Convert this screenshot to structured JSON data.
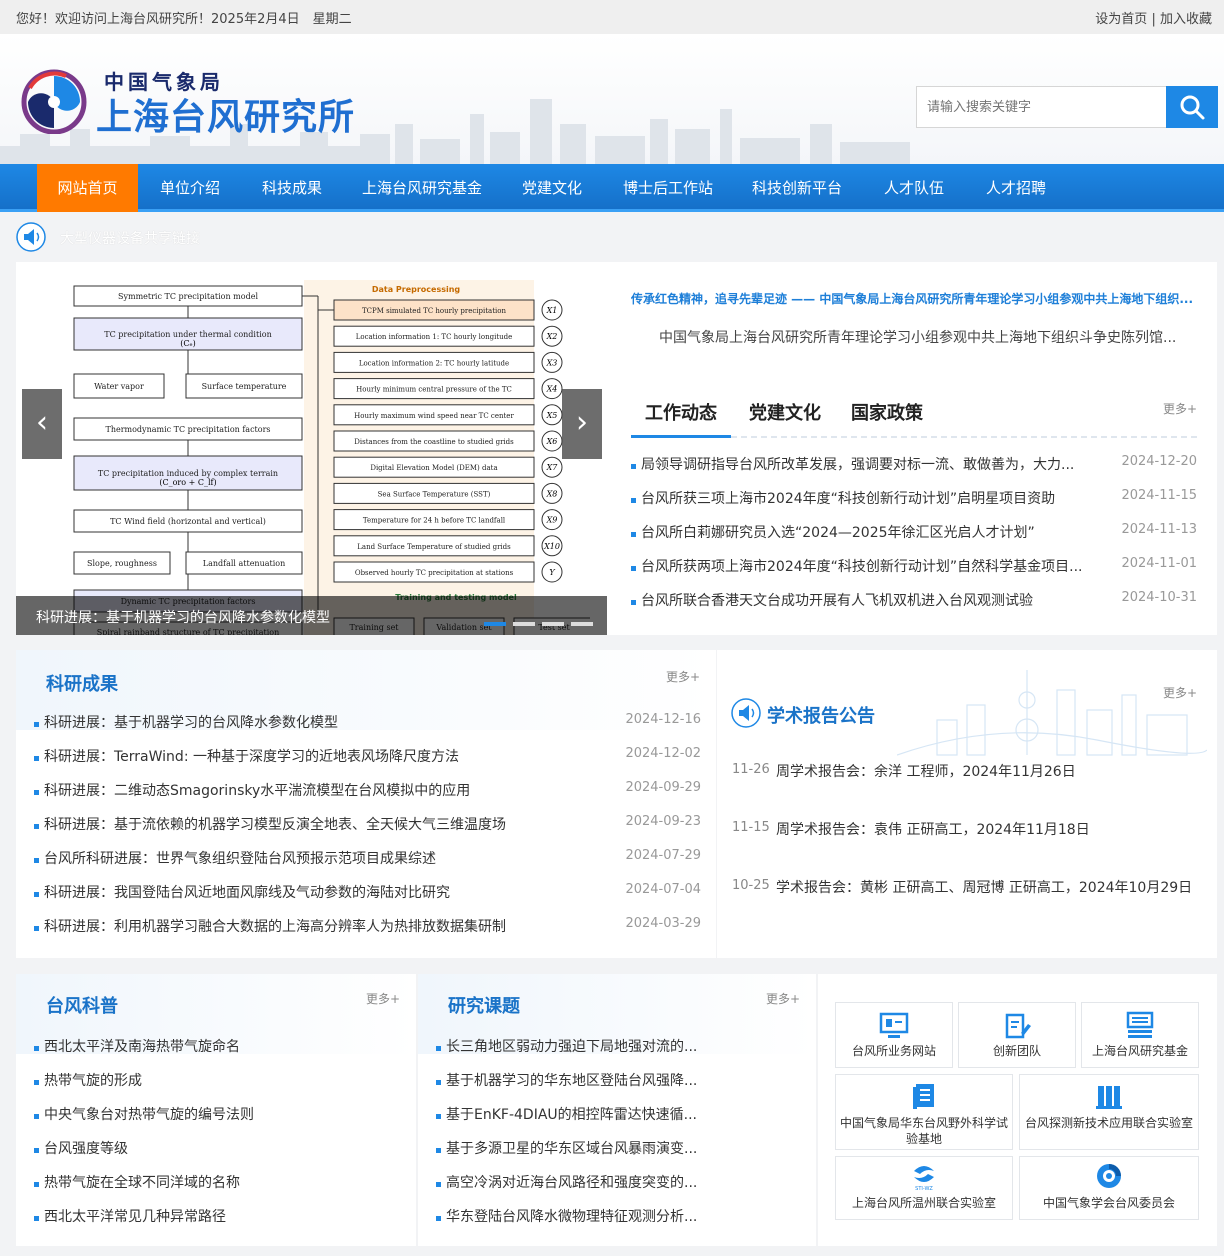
{
  "topbar": {
    "welcome": "您好！欢迎访问上海台风研究所！2025年2月4日　星期二",
    "set_home": "设为首页",
    "sep": "|",
    "favorite": "加入收藏"
  },
  "header": {
    "org": "中国气象局",
    "name": "上海台风研究所",
    "search_placeholder": "请输入搜索关键字"
  },
  "nav": {
    "items": [
      "网站首页",
      "单位介绍",
      "科技成果",
      "上海台风研究基金",
      "党建文化",
      "博士后工作站",
      "科技创新平台",
      "人才队伍",
      "人才招聘"
    ],
    "active_index": 0
  },
  "notice": {
    "text": "大型仪器设备共享链接"
  },
  "slider": {
    "caption": "科研进展：基于机器学习的台风降水参数化模型",
    "dot_count": 5,
    "active_dot": 0,
    "figure": {
      "left_boxes": [
        "Symmetric TC precipitation model",
        "TC precipitation under thermal condition",
        "(Cₑ)",
        "Water vapor",
        "Surface temperature",
        "Thermodynamic TC precipitation factors",
        "TC precipitation induced by complex terrain",
        "(C_oro + C_lf)",
        "TC Wind field (horizontal and vertical)",
        "Slope, roughness",
        "Landfall attenuation",
        "Dynamic TC precipitation factors",
        "Spiral rainband structure of TC precipitation"
      ],
      "header": "Data Preprocessing",
      "right_boxes": [
        "TCPM simulated TC hourly precipitation",
        "Location information 1: TC hourly longitude",
        "Location information 2: TC hourly latitude",
        "Hourly minimum central pressure of the TC",
        "Hourly maximum wind speed near TC center",
        "Distances from the coastline to studied grids",
        "Digital Elevation Model (DEM) data",
        "Sea Surface Temperature (SST)",
        "Temperature for 24 h before TC landfall",
        "Land Surface Temperature of studied grids",
        "Observed hourly TC precipitation at stations"
      ],
      "x_labels": [
        "X1",
        "X2",
        "X3",
        "X4",
        "X5",
        "X6",
        "X7",
        "X8",
        "X9",
        "X10",
        "Y"
      ],
      "bottom_header": "Training and testing model",
      "bottom_boxes": [
        "Training set",
        "Validation set",
        "Test set"
      ]
    }
  },
  "featured": {
    "headline": "传承红色精神，追寻先辈足迹 —— 中国气象局上海台风研究所青年理论学习小组参观中共上海地下组织...",
    "summary": "中国气象局上海台风研究所青年理论学习小组参观中共上海地下组织斗争史陈列馆..."
  },
  "tabs": {
    "items": [
      "工作动态",
      "党建文化",
      "国家政策"
    ],
    "active": 0,
    "more": "更多+"
  },
  "news": [
    {
      "title": "局领导调研指导台风所改革发展，强调要对标一流、敢做善为，大力...",
      "date": "2024-12-20"
    },
    {
      "title": "台风所获三项上海市2024年度“科技创新行动计划”启明星项目资助",
      "date": "2024-11-15"
    },
    {
      "title": "台风所白莉娜研究员入选“2024—2025年徐汇区光启人才计划”",
      "date": "2024-11-13"
    },
    {
      "title": "台风所获两项上海市2024年度“科技创新行动计划”自然科学基金项目...",
      "date": "2024-11-01"
    },
    {
      "title": "台风所联合香港天文台成功开展有人飞机双机进入台风观测试验",
      "date": "2024-10-31"
    }
  ],
  "research": {
    "title": "科研成果",
    "more": "更多+",
    "items": [
      {
        "title": "科研进展：基于机器学习的台风降水参数化模型",
        "date": "2024-12-16"
      },
      {
        "title": "科研进展：TerraWind: 一种基于深度学习的近地表风场降尺度方法",
        "date": "2024-12-02"
      },
      {
        "title": "科研进展：二维动态Smagorinsky水平湍流模型在台风模拟中的应用",
        "date": "2024-09-29"
      },
      {
        "title": "科研进展：基于流依赖的机器学习模型反演全地表、全天候大气三维温度场",
        "date": "2024-09-23"
      },
      {
        "title": "台风所科研进展：世界气象组织登陆台风预报示范项目成果综述",
        "date": "2024-07-29"
      },
      {
        "title": "科研进展：我国登陆台风近地面风廓线及气动参数的海陆对比研究",
        "date": "2024-07-04"
      },
      {
        "title": "科研进展：利用机器学习融合大数据的上海高分辨率人为热排放数据集研制",
        "date": "2024-03-29"
      }
    ]
  },
  "reports": {
    "title": "学术报告公告",
    "more": "更多+",
    "items": [
      {
        "date": "11-26",
        "title": "周学术报告会：余洋 工程师，2024年11月26日"
      },
      {
        "date": "11-15",
        "title": "周学术报告会：袁伟 正研高工，2024年11月18日"
      },
      {
        "date": "10-25",
        "title": "学术报告会：黄彬 正研高工、周冠博 正研高工，2024年10月29日"
      }
    ]
  },
  "science": {
    "title": "台风科普",
    "more": "更多+",
    "items": [
      "西北太平洋及南海热带气旋命名",
      "热带气旋的形成",
      "中央气象台对热带气旋的编号法则",
      "台风强度等级",
      "热带气旋在全球不同洋域的名称",
      "西北太平洋常见几种异常路径"
    ]
  },
  "projects": {
    "title": "研究课题",
    "more": "更多+",
    "items": [
      "长三角地区弱动力强迫下局地强对流的...",
      "基于机器学习的华东地区登陆台风强降...",
      "基于EnKF-4DIAU的相控阵雷达快速循...",
      "基于多源卫星的华东区域台风暴雨演变...",
      "高空冷涡对近海台风路径和强度突变的...",
      "华东登陆台风降水微物理特征观测分析..."
    ]
  },
  "quicklinks": [
    {
      "label": "台风所业务网站",
      "icon": "monitor-icon"
    },
    {
      "label": "创新团队",
      "icon": "edit-doc-icon"
    },
    {
      "label": "上海台风研究基金",
      "icon": "server-icon"
    },
    {
      "label": "中国气象局华东台风野外科学试验基地",
      "icon": "book-icon"
    },
    {
      "label": "台风探测新技术应用联合实验室",
      "icon": "lab-icon"
    },
    {
      "label": "上海台风所温州联合实验室",
      "icon": "wz-logo-icon"
    },
    {
      "label": "中国气象学会台风委员会",
      "icon": "typhoon-logo-icon"
    }
  ],
  "colors": {
    "primary": "#1e88e5",
    "active_nav": "#ff7a00",
    "title_blue": "#1a73c8"
  }
}
